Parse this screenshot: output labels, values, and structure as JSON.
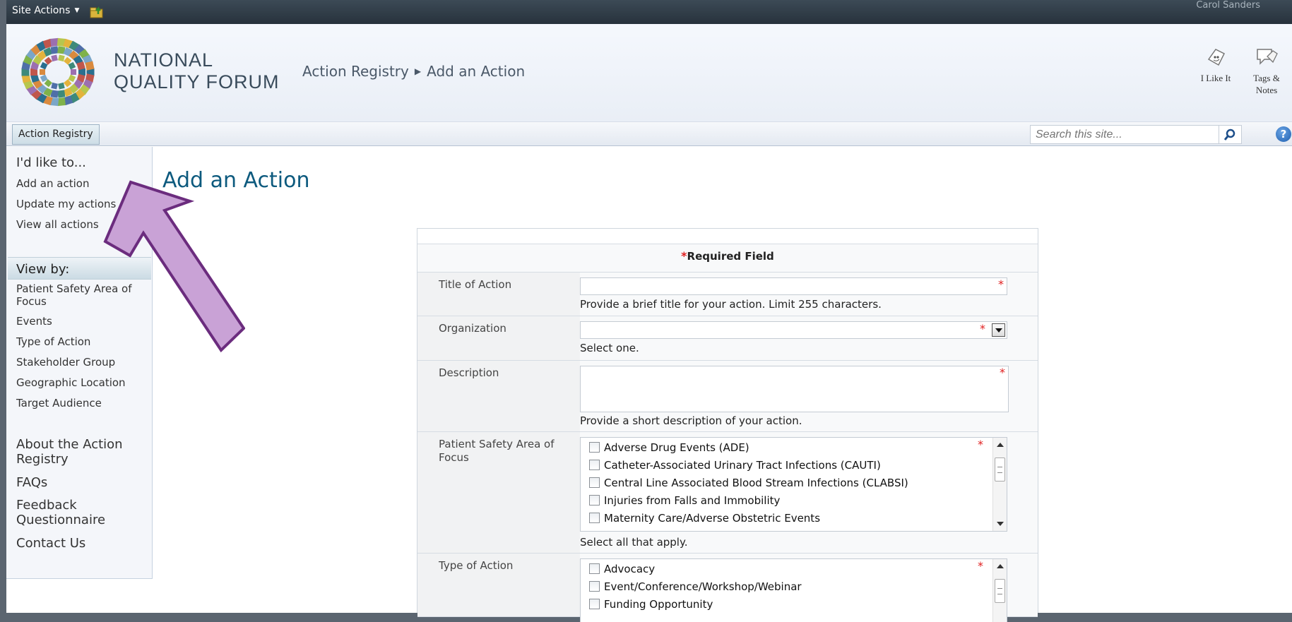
{
  "topbar": {
    "site_actions": "Site Actions",
    "user_name": "Carol Sanders"
  },
  "header": {
    "logo_line1": "NATIONAL",
    "logo_line2": "QUALITY FORUM",
    "breadcrumb": [
      "Action Registry",
      "Add an Action"
    ],
    "like_label": "I Like It",
    "tags_label": [
      "Tags &",
      "Notes"
    ]
  },
  "navbar": {
    "tab": "Action Registry",
    "search_placeholder": "Search this site...",
    "help": "?"
  },
  "sidebar": {
    "heading1": "I'd like to...",
    "actions": [
      "Add an action",
      "Update my actions",
      "View all actions"
    ],
    "heading2": "View by:",
    "view_by": [
      "Patient Safety Area of Focus",
      "Events",
      "Type of Action",
      "Stakeholder Group",
      "Geographic Location",
      "Target Audience"
    ],
    "links": [
      "About the Action Registry",
      "FAQs",
      "Feedback Questionnaire",
      "Contact Us"
    ]
  },
  "page": {
    "title": "Add an Action"
  },
  "form": {
    "required_star": "*",
    "required_label": "Required Field",
    "title": {
      "label": "Title of Action",
      "value": "",
      "hint": "Provide a brief title for your action. Limit 255 characters."
    },
    "organization": {
      "label": "Organization",
      "value": "",
      "hint": "Select one."
    },
    "description": {
      "label": "Description",
      "value": "",
      "hint": "Provide a short description of your action."
    },
    "focus": {
      "label": "Patient Safety Area of Focus",
      "options": [
        "Adverse Drug Events (ADE)",
        "Catheter-Associated Urinary Tract Infections (CAUTI)",
        "Central Line Associated Blood Stream Infections (CLABSI)",
        "Injuries from Falls and Immobility",
        "Maternity Care/Adverse Obstetric Events"
      ],
      "hint": "Select all that apply."
    },
    "type": {
      "label": "Type of Action",
      "options": [
        "Advocacy",
        "Event/Conference/Workshop/Webinar",
        "Funding Opportunity"
      ]
    }
  },
  "colors": {
    "title_blue": "#0d5a7e",
    "required_red": "#e02020",
    "annotation_arrow": "#c9a2d6"
  }
}
